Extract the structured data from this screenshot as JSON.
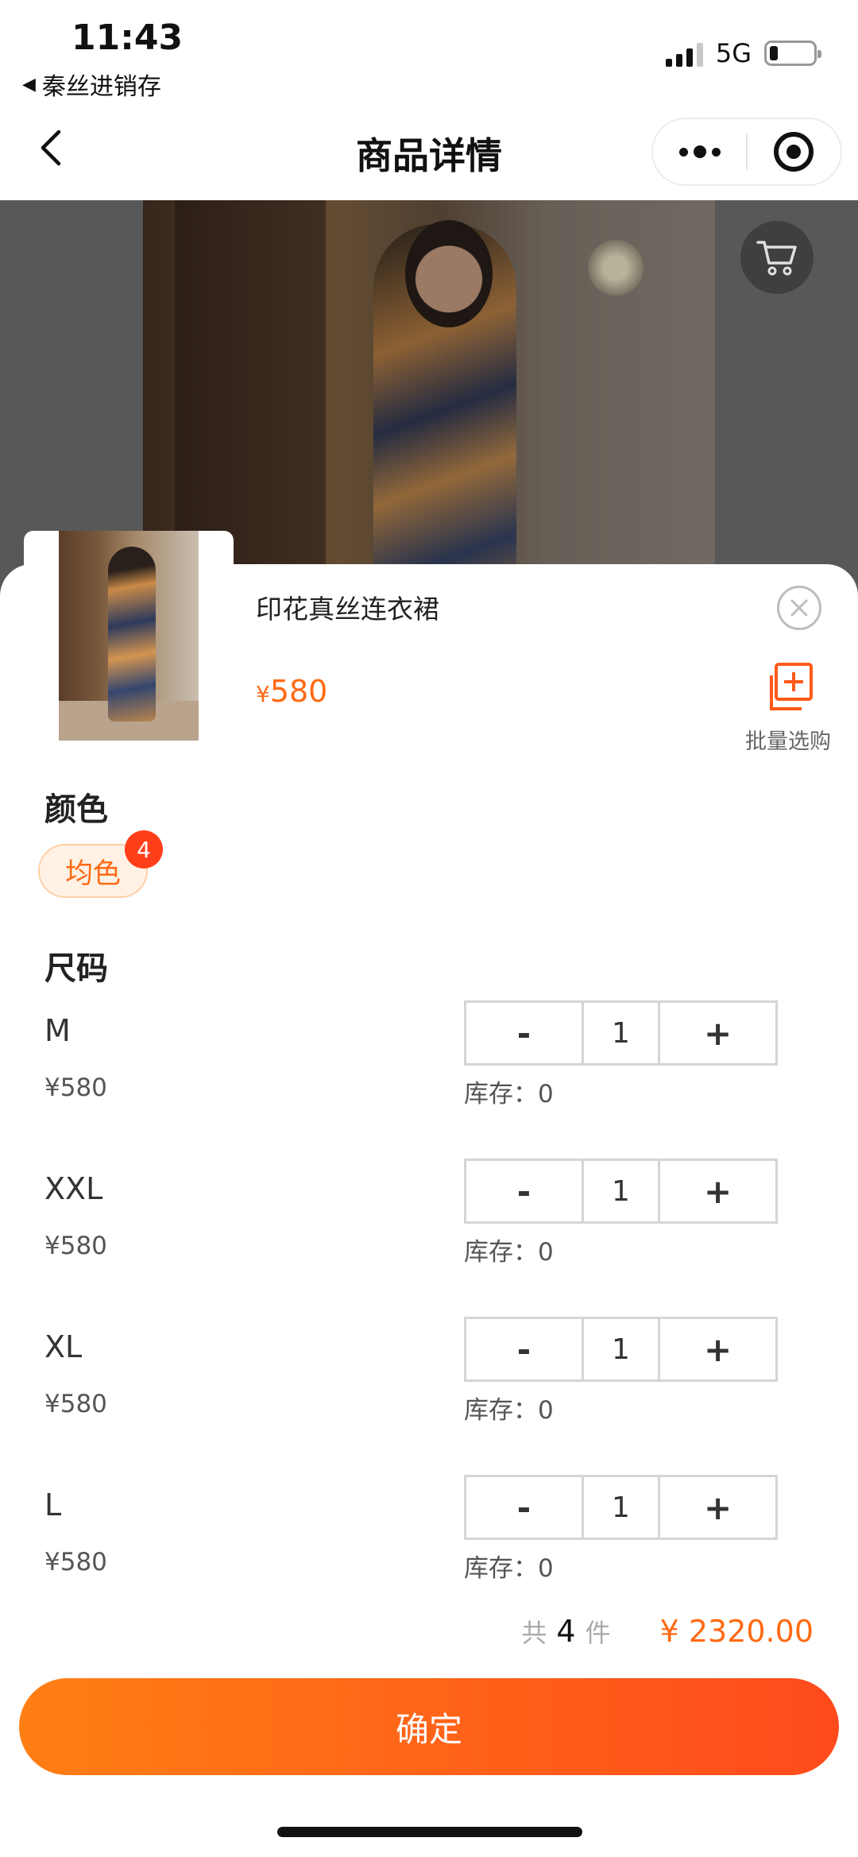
{
  "status_bar": {
    "time": "11:43",
    "back_app": "秦丝进销存",
    "network": "5G",
    "battery_level": 0.2
  },
  "nav": {
    "title": "商品详情"
  },
  "product": {
    "title": "印花真丝连衣裙",
    "currency": "¥",
    "price": "580"
  },
  "batch": {
    "label": "批量选购"
  },
  "color": {
    "section_label": "颜色",
    "selected": "均色",
    "badge_count": "4"
  },
  "size": {
    "section_label": "尺码",
    "stock_label": "库存：",
    "items": [
      {
        "name": "M",
        "price": "¥580",
        "qty": "1",
        "stock": "0"
      },
      {
        "name": "XXL",
        "price": "¥580",
        "qty": "1",
        "stock": "0"
      },
      {
        "name": "XL",
        "price": "¥580",
        "qty": "1",
        "stock": "0"
      },
      {
        "name": "L",
        "price": "¥580",
        "qty": "1",
        "stock": "0"
      }
    ],
    "minus_label": "-",
    "plus_label": "+"
  },
  "summary": {
    "prefix": "共",
    "count": "4",
    "suffix": "件",
    "total": "¥ 2320.00"
  },
  "confirm": {
    "label": "确定"
  },
  "colors": {
    "accent": "#ff6a13",
    "badge": "#ff3f1a",
    "button_start": "#ff7f14",
    "button_end": "#ff4a1c"
  },
  "icons": {
    "back": "chevron-left-icon",
    "more": "more-dots-icon",
    "target": "target-icon",
    "cart": "cart-icon",
    "close": "close-icon",
    "batch": "batch-add-icon"
  }
}
